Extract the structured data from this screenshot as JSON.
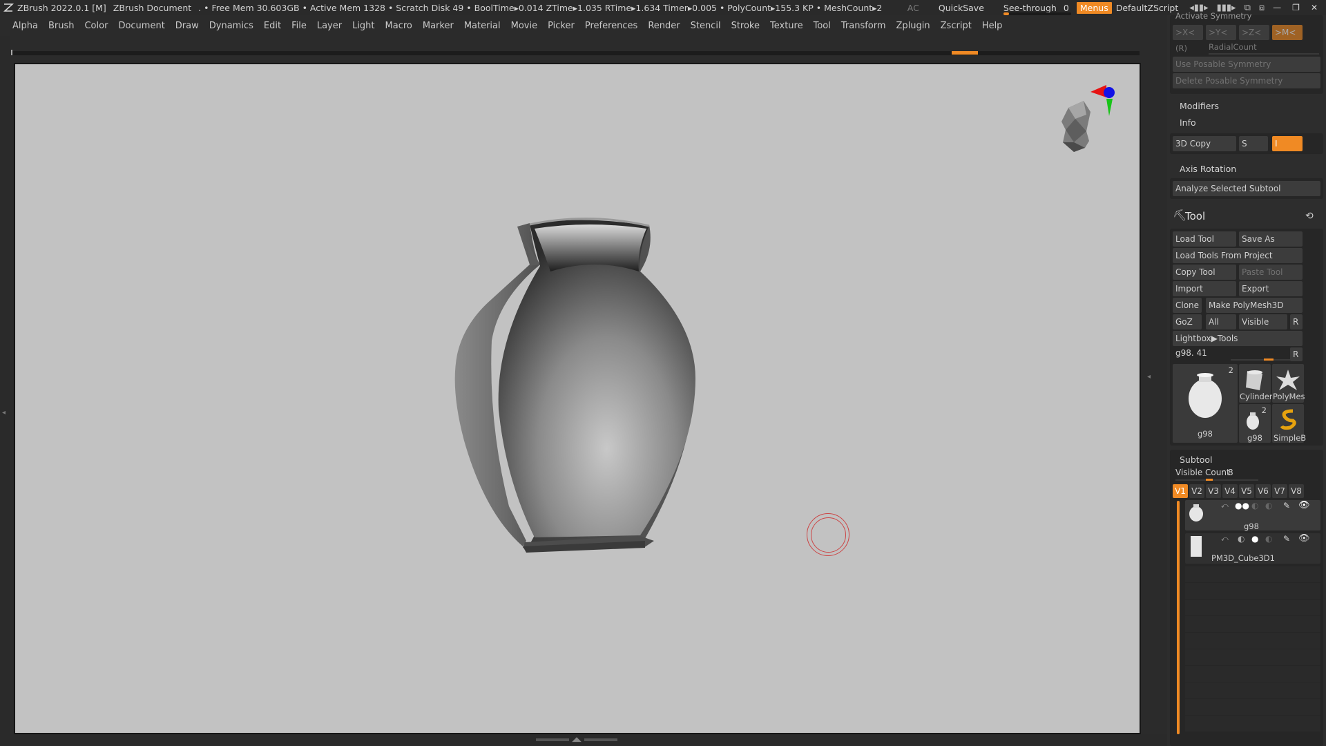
{
  "titlebar": {
    "app": "ZBrush 2022.0.1 [M]",
    "document": "ZBrush Document",
    "stats": ". • Free Mem 30.603GB • Active Mem 1328 • Scratch Disk 49 •  BoolTime▸0.014 ZTime▸1.035 RTime▸1.634 Timer▸0.005 • PolyCount▸155.3 KP  • MeshCount▸2",
    "ac": "AC",
    "quicksave": "QuickSave",
    "seethrough_label": "See-through",
    "seethrough_value": "0",
    "seethrough_level": 0.0,
    "menus": "Menus",
    "defaultzscript": "DefaultZScript",
    "icons": [
      "layout-arrows-icon",
      "grid-bars-icon",
      "window-layers-icon",
      "window-stack-icon"
    ],
    "window_controls": [
      "minimize-icon",
      "restore-icon",
      "close-icon"
    ]
  },
  "menubar": {
    "items": [
      "Alpha",
      "Brush",
      "Color",
      "Document",
      "Draw",
      "Dynamics",
      "Edit",
      "File",
      "Layer",
      "Light",
      "Macro",
      "Marker",
      "Material",
      "Movie",
      "Picker",
      "Preferences",
      "Render",
      "Stencil",
      "Stroke",
      "Texture",
      "Tool",
      "Transform",
      "Zplugin",
      "Zscript",
      "Help"
    ]
  },
  "panel": {
    "symmetry": {
      "header": "Activate Symmetry",
      "x": ">X<",
      "y": ">Y<",
      "z": ">Z<",
      "m": ">M<",
      "r": "(R)",
      "radial": "RadialCount",
      "use_posable": "Use Posable Symmetry",
      "delete_posable": "Delete Posable Symmetry"
    },
    "modifiers": "Modifiers",
    "info": "Info",
    "copy3d": {
      "label": "3D Copy",
      "s": "S",
      "i": "I"
    },
    "axis_rotation": "Axis Rotation",
    "analyze": "Analyze Selected Subtool",
    "tool": {
      "title": "Tool",
      "load_tool": "Load Tool",
      "save_as": "Save As",
      "load_from_project": "Load Tools From Project",
      "copy_tool": "Copy Tool",
      "paste_tool": "Paste Tool",
      "import": "Import",
      "export": "Export",
      "clone": "Clone",
      "make_polymesh": "Make PolyMesh3D",
      "goz": "GoZ",
      "all": "All",
      "visible": "Visible",
      "r": "R",
      "lightbox": "Lightbox▶Tools",
      "current": "g98. 41",
      "current_r": "R",
      "thumbs": {
        "main_label": "g98",
        "main_count": "2",
        "cylinder": "Cylinder",
        "polymesh": "PolyMes",
        "small_g98": "g98",
        "small_count": "2",
        "simpleb": "SimpleB"
      }
    },
    "subtool": {
      "title": "Subtool",
      "visible_count_label": "Visible Count",
      "visible_count_value": "8",
      "tabs": [
        "V1",
        "V2",
        "V3",
        "V4",
        "V5",
        "V6",
        "V7",
        "V8"
      ],
      "items": [
        {
          "name": "g98"
        },
        {
          "name": "PM3D_Cube3D1"
        }
      ]
    }
  }
}
